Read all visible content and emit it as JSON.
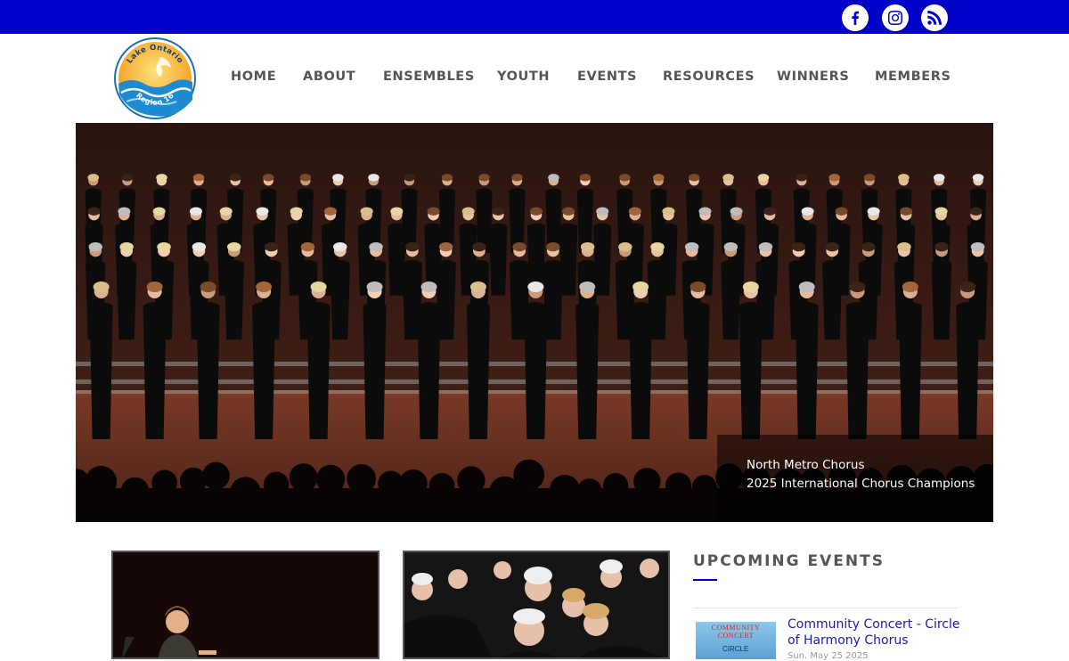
{
  "topbar": {
    "color": "#0000c8",
    "social": [
      {
        "name": "facebook-icon"
      },
      {
        "name": "instagram-icon"
      },
      {
        "name": "rss-icon"
      }
    ]
  },
  "logo": {
    "line1": "Lake Ontario",
    "line2": "Region 16"
  },
  "nav": {
    "items": [
      "HOME",
      "ABOUT",
      "ENSEMBLES",
      "YOUTH",
      "EVENTS",
      "RESOURCES",
      "WINNERS",
      "MEMBERS"
    ]
  },
  "hero": {
    "caption_line1": "North Metro Chorus",
    "caption_line2": "2025 International Chorus Champions"
  },
  "events": {
    "heading": "UPCOMING EVENTS",
    "accent": "#0000c8",
    "items": [
      {
        "thumb_line1": "COMMUNITY",
        "thumb_line2": "CONCERT",
        "thumb_line3": "CIRCLE",
        "title": "Community Concert - Circle of Harmony Chorus",
        "date": "Sun. May 25 2025"
      }
    ]
  }
}
